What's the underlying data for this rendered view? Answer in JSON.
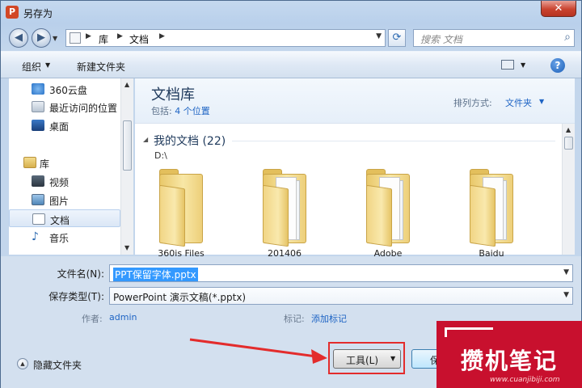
{
  "window": {
    "title": "另存为",
    "close_glyph": "✕"
  },
  "address_bar": {
    "crumbs": [
      "库",
      "文档"
    ],
    "search_placeholder": "搜索 文档"
  },
  "toolbar": {
    "organize": "组织",
    "new_folder": "新建文件夹",
    "help_glyph": "?"
  },
  "sidebar": {
    "items": [
      {
        "label": "360云盘",
        "icon": "cloud-drive-icon",
        "group": false
      },
      {
        "label": "最近访问的位置",
        "icon": "recent-places-icon",
        "group": false
      },
      {
        "label": "桌面",
        "icon": "desktop-icon",
        "group": false
      },
      {
        "label": "库",
        "icon": "library-icon",
        "group": true
      },
      {
        "label": "视频",
        "icon": "video-icon",
        "group": false
      },
      {
        "label": "图片",
        "icon": "pictures-icon",
        "group": false
      },
      {
        "label": "文档",
        "icon": "documents-icon",
        "group": false,
        "selected": true
      },
      {
        "label": "音乐",
        "icon": "music-icon",
        "group": false
      }
    ]
  },
  "library": {
    "title": "文档库",
    "includes_prefix": "包括:",
    "includes_link": "4 个位置",
    "arrange_label": "排列方式:",
    "arrange_value": "文件夹",
    "group_title": "我的文档 (22)",
    "group_path": "D:\\",
    "folders": [
      {
        "name": "360js Files"
      },
      {
        "name": "201406"
      },
      {
        "name": "Adobe"
      },
      {
        "name": "Baidu"
      }
    ]
  },
  "form": {
    "filename_label": "文件名(N):",
    "filename_value": "PPT保留字体.pptx",
    "filetype_label": "保存类型(T):",
    "filetype_value": "PowerPoint 演示文稿(*.pptx)",
    "author_label": "作者:",
    "author_value": "admin",
    "tags_label": "标记:",
    "tags_value": "添加标记",
    "hide_folders": "隐藏文件夹",
    "tools_button": "工具(L)",
    "save_button": "保"
  },
  "watermark": {
    "text": "攒机笔记",
    "url": "www.cuanjibiji.com"
  },
  "colors": {
    "highlight_box": "#e32c2c",
    "link": "#1e64c4",
    "watermark_bg": "#c8102e"
  }
}
